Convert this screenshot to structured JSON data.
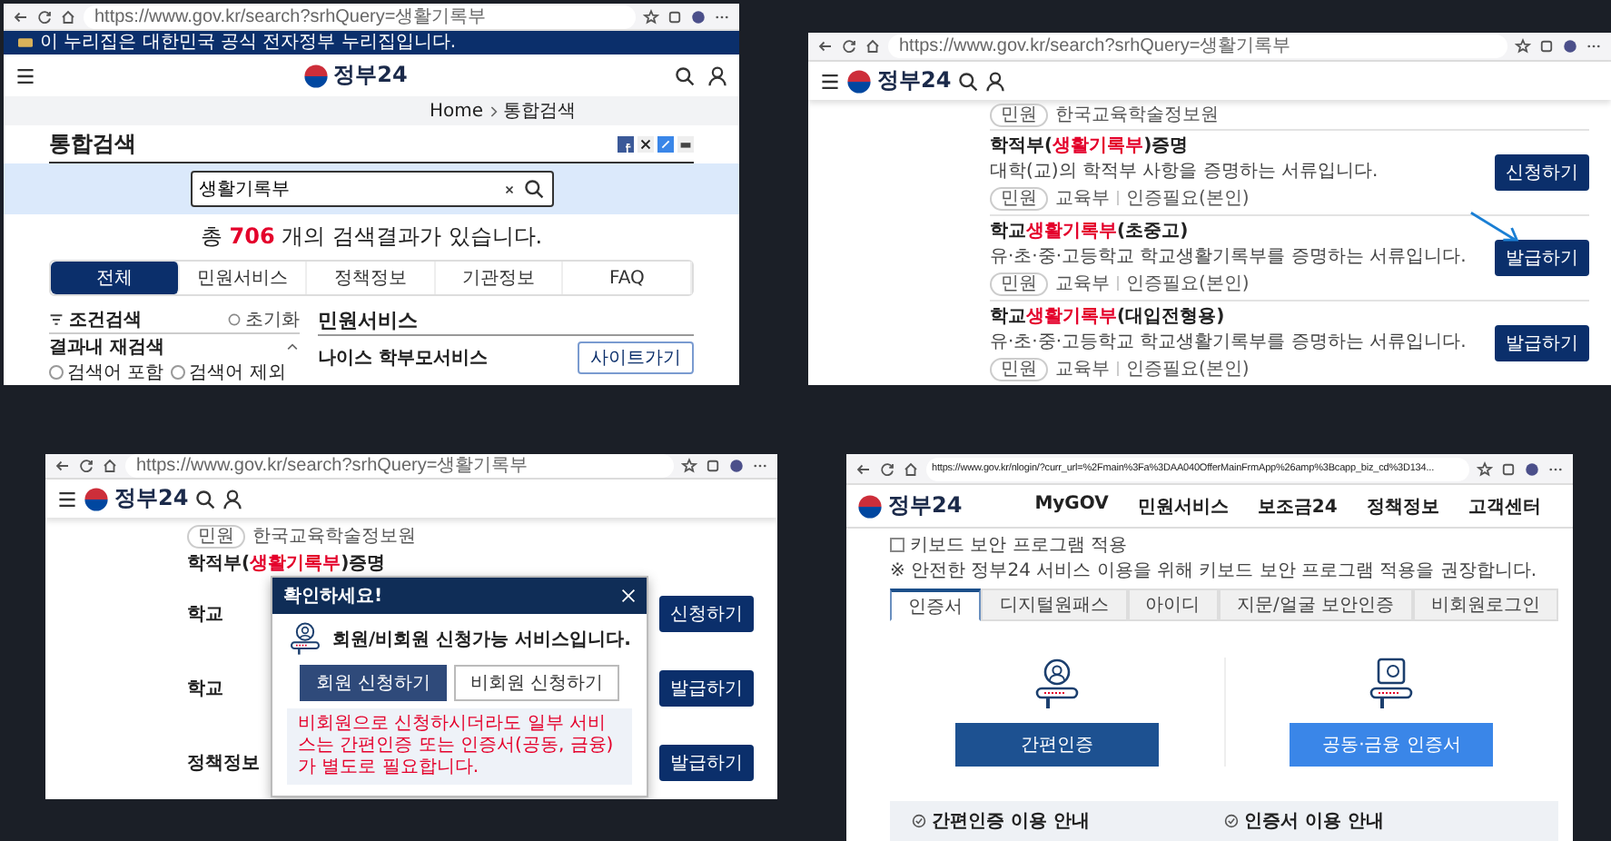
{
  "search_window": {
    "address": "https://www.gov.kr/search?srhQuery=생활기록부",
    "banner": "이 누리집은 대한민국 공식 전자정부 누리집입니다.",
    "logo": "정부24",
    "breadcrumb": [
      "Home",
      "통합검색"
    ],
    "title": "통합검색",
    "query": "생활기록부",
    "count_prefix": "총",
    "count": "706",
    "count_suffix": "개의 검색결과가 있습니다.",
    "tabs": [
      {
        "label": "전체",
        "selected": true
      },
      {
        "label": "민원서비스",
        "selected": false
      },
      {
        "label": "정책정보",
        "selected": false
      },
      {
        "label": "기관정보",
        "selected": false
      },
      {
        "label": "FAQ",
        "selected": false
      }
    ],
    "filter": {
      "title": "조건검색",
      "reset": "초기화",
      "section": "결과내 재검색",
      "options": [
        {
          "label": "검색어 포함",
          "selected": false
        },
        {
          "label": "검색어 제외",
          "selected": false
        }
      ]
    },
    "section_title": "민원서비스",
    "result_title": "나이스 학부모서비스",
    "result_button": "사이트가기"
  },
  "results_window": {
    "address": "https://www.gov.kr/search?srhQuery=생활기록부",
    "logo": "정부24",
    "top_row": {
      "type": "민원",
      "agency": "한국교육학술정보원"
    },
    "rows": [
      {
        "title_before": "학적부(",
        "title_highlight": "생활기록부",
        "title_after": ")증명",
        "description": "대학(교)의 학적부 사항을 증명하는 서류입니다.",
        "type": "민원",
        "agency": "교육부",
        "auth": "인증필요(본인)",
        "button": "신청하기",
        "pointed": false
      },
      {
        "title_before": "학교",
        "title_highlight": "생활기록부",
        "title_after": "(초중고)",
        "description": "유·초·중·고등학교 학교생활기록부를 증명하는 서류입니다.",
        "type": "민원",
        "agency": "교육부",
        "auth": "인증필요(본인)",
        "button": "발급하기",
        "pointed": true
      },
      {
        "title_before": "학교",
        "title_highlight": "생활기록부",
        "title_after": "(대입전형용)",
        "description": "유·초·중·고등학교 학교생활기록부를 증명하는 서류입니다.",
        "type": "민원",
        "agency": "교육부",
        "auth": "인증필요(본인)",
        "button": "발급하기",
        "pointed": false
      }
    ]
  },
  "dialog_window": {
    "address": "https://www.gov.kr/search?srhQuery=생활기록부",
    "logo": "정부24",
    "top_row": {
      "type": "민원",
      "agency": "한국교육학술정보원"
    },
    "title_before": "학적부(",
    "title_highlight": "생활기록부",
    "title_after": ")증명",
    "row_fragments": [
      "학교",
      "학교"
    ],
    "section_title": "정책정보",
    "buttons": [
      "신청하기",
      "발급하기",
      "발급하기"
    ],
    "dialog": {
      "title": "확인하세요!",
      "message": "회원/비회원 신청가능 서비스입니다.",
      "actions": [
        {
          "label": "회원 신청하기",
          "primary": true
        },
        {
          "label": "비회원 신청하기",
          "primary": false
        }
      ],
      "note": "비회원으로 신청하시더라도 일부 서비스는 간편인증 또는 인증서(공동, 금융)가 별도로 필요합니다."
    }
  },
  "login_window": {
    "address": "https://www.gov.kr/nlogin/?curr_url=%2Fmain%3Fa%3DAA040OfferMainFrmApp%26amp%3Bcapp_biz_cd%3D134...",
    "logo": "정부24",
    "nav": [
      "MyGOV",
      "민원서비스",
      "보조금24",
      "정책정보",
      "고객센터"
    ],
    "keyboard_security": {
      "label": "키보드 보안 프로그램 적용",
      "checked": false
    },
    "note": "※ 안전한 정부24 서비스 이용을 위해 키보드 보안 프로그램 적용을 권장합니다.",
    "tabs": [
      {
        "label": "인증서",
        "selected": true
      },
      {
        "label": "디지털원패스",
        "selected": false
      },
      {
        "label": "아이디",
        "selected": false
      },
      {
        "label": "지문/얼굴 보안인증",
        "selected": false
      },
      {
        "label": "비회원로그인",
        "selected": false
      }
    ],
    "methods": [
      {
        "kind": "simple",
        "button": "간편인증"
      },
      {
        "kind": "certificate",
        "button": "공동·금융 인증서"
      }
    ],
    "guides": [
      "간편인증 이용 안내",
      "인증서 이용 안내"
    ]
  }
}
